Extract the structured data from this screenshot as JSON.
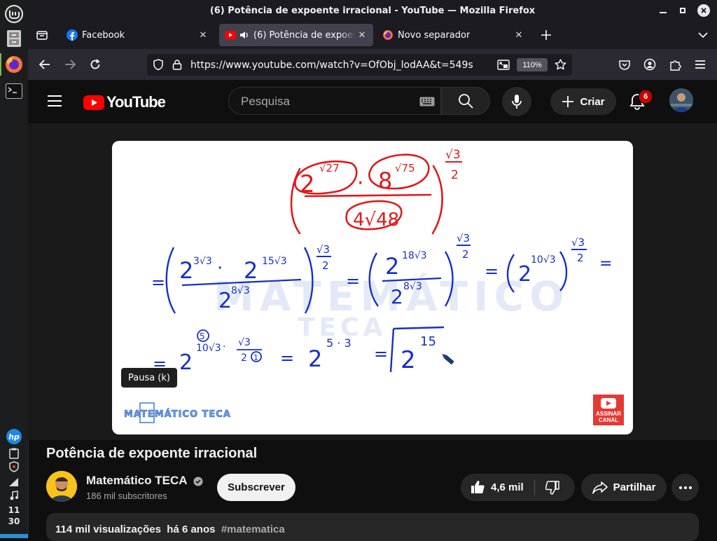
{
  "taskbar": {
    "clock_hour": "11",
    "clock_minute": "30"
  },
  "window": {
    "title": "(6) Potência de expoente irracional - YouTube — Mozilla Firefox"
  },
  "tabs": [
    {
      "label": "Facebook",
      "active": false
    },
    {
      "label": "(6) Potência de expoente irracional - YouTube",
      "active": true
    },
    {
      "label": "Novo separador",
      "active": false
    }
  ],
  "navbar": {
    "url": "https://www.youtube.com/watch?v=OfObj_lodAA&t=549s",
    "zoom": "110%"
  },
  "youtube": {
    "logo_text": "YouTube",
    "search_placeholder": "Pesquisa",
    "create_label": "Criar",
    "notifications_count": "6"
  },
  "video": {
    "tooltip": "Pausa (k)",
    "watermark": "MATEMÁTICO TECA",
    "subscribe_badge_line1": "ASSINAR",
    "subscribe_badge_line2": "CANAL"
  },
  "details": {
    "title": "Potência de expoente irracional",
    "channel_name": "Matemático TECA",
    "subscribers": "186 mil subscritores",
    "subscribe_label": "Subscrever",
    "likes": "4,6 mil",
    "share_label": "Partilhar",
    "views": "114 mil visualizações",
    "age": "há 6 anos",
    "hashtag": "#matematica"
  },
  "colors": {
    "yt_red": "#ff0000",
    "ink_blue": "#1530c8",
    "ink_red": "#e01a1a",
    "firefox_bg": "#1c1b22"
  }
}
